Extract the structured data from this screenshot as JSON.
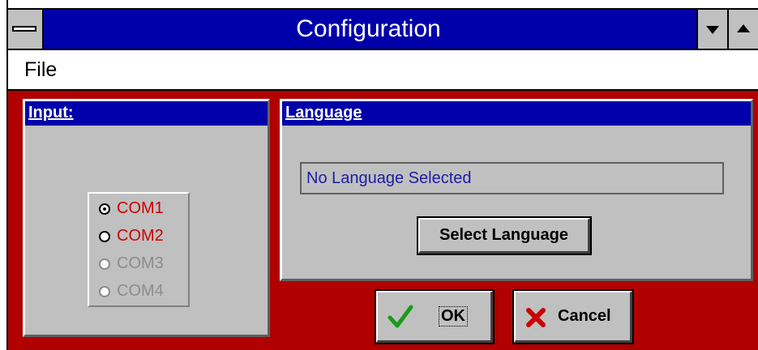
{
  "window": {
    "title": "Configuration"
  },
  "menu": {
    "items": [
      "File"
    ]
  },
  "input_panel": {
    "heading": "Input:",
    "options": [
      {
        "label": "COM1",
        "selected": true,
        "enabled": true
      },
      {
        "label": "COM2",
        "selected": false,
        "enabled": true
      },
      {
        "label": "COM3",
        "selected": false,
        "enabled": false
      },
      {
        "label": "COM4",
        "selected": false,
        "enabled": false
      }
    ]
  },
  "language_panel": {
    "heading": "Language",
    "current_value": "No Language Selected",
    "select_button": "Select Language"
  },
  "buttons": {
    "ok": "OK",
    "cancel": "Cancel"
  },
  "icons": {
    "ok": "checkmark-icon",
    "cancel": "x-icon"
  },
  "colors": {
    "title_bar": "#0000aa",
    "client_background": "#b00000",
    "panel": "#c0c0c0",
    "enabled_option_text": "#cc0000",
    "disabled_option_text": "#8c8c8c",
    "ok_check": "#1a9a1a",
    "cancel_x": "#cc0000"
  }
}
